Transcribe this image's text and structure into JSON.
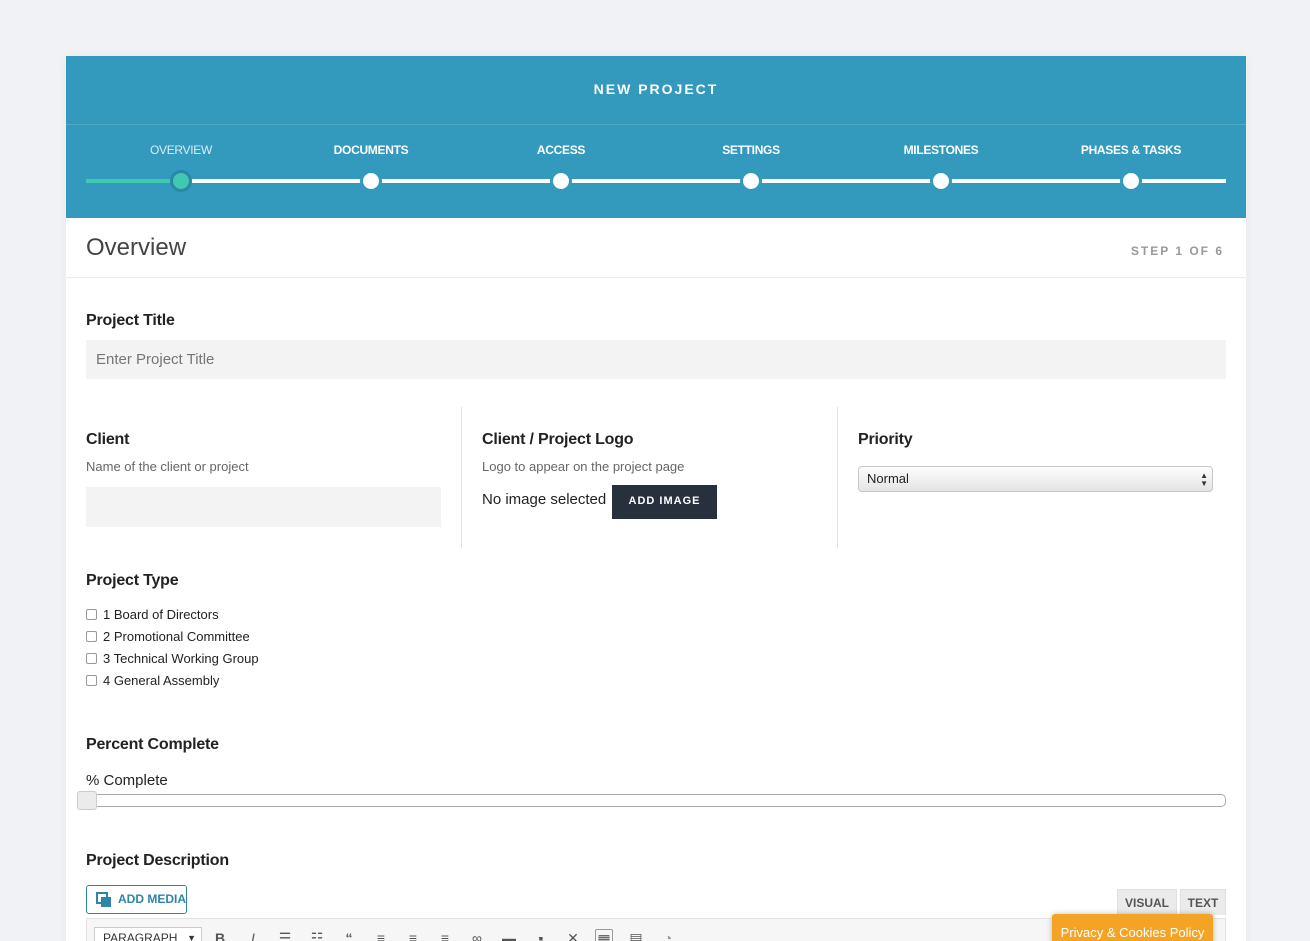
{
  "header": {
    "title": "NEW PROJECT",
    "progress_fraction": 0.083,
    "steps": [
      {
        "label": "OVERVIEW",
        "active": true
      },
      {
        "label": "DOCUMENTS",
        "active": false
      },
      {
        "label": "ACCESS",
        "active": false
      },
      {
        "label": "SETTINGS",
        "active": false
      },
      {
        "label": "MILESTONES",
        "active": false
      },
      {
        "label": "PHASES & TASKS",
        "active": false
      }
    ]
  },
  "section": {
    "title": "Overview",
    "step_text": "STEP 1 OF 6"
  },
  "project_title": {
    "label": "Project Title",
    "placeholder": "Enter Project Title"
  },
  "client": {
    "label": "Client",
    "hint": "Name of the client or project",
    "value": ""
  },
  "logo": {
    "label": "Client / Project Logo",
    "hint": "Logo to appear on the project page",
    "status": "No image selected",
    "button": "ADD IMAGE"
  },
  "priority": {
    "label": "Priority",
    "selected": "Normal"
  },
  "project_type": {
    "label": "Project Type",
    "options": [
      {
        "label": "1 Board of Directors",
        "checked": false
      },
      {
        "label": "2 Promotional Committee",
        "checked": false
      },
      {
        "label": "3 Technical Working Group",
        "checked": false
      },
      {
        "label": "4 General Assembly",
        "checked": false
      }
    ]
  },
  "percent": {
    "label": "Percent Complete",
    "sublabel": "% Complete",
    "value": 0
  },
  "description": {
    "label": "Project Description",
    "add_media": "ADD MEDIA",
    "tab_visual": "VISUAL",
    "tab_text": "TEXT",
    "format_select": "PARAGRAPH"
  },
  "cookie": {
    "label": "Privacy & Cookies Policy"
  },
  "colors": {
    "header": "#3399bd",
    "accent": "#3fc9b0",
    "dark_button": "#27313d",
    "cookie": "#f3a425"
  }
}
